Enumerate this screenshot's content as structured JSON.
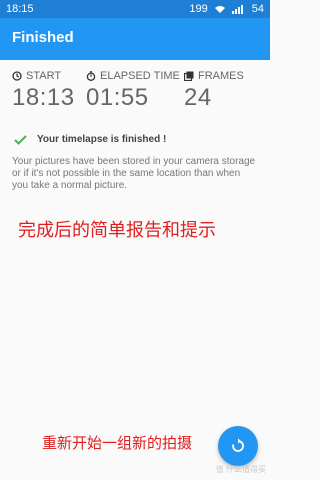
{
  "status_bar": {
    "time": "18:15",
    "battery_pct": "199",
    "battery_level": "54"
  },
  "app_bar": {
    "title": "Finished"
  },
  "stats": {
    "start": {
      "label": "START",
      "value": "18:13",
      "icon": "clock-icon"
    },
    "elapsed": {
      "label": "ELAPSED TIME",
      "value": "01:55",
      "icon": "stopwatch-icon"
    },
    "frames": {
      "label": "FRAMES",
      "value": "24",
      "icon": "frames-icon"
    }
  },
  "message": {
    "title": "Your timelapse is finished !",
    "description": "Your pictures have been stored in your camera storage or if it's not possible in the same location than when you take a normal picture."
  },
  "annotations": {
    "top": "完成后的简单报告和提示",
    "bottom": "重新开始一组新的拍摄"
  },
  "fab": {
    "icon": "restart-icon"
  },
  "watermark": "值 什么值得买"
}
